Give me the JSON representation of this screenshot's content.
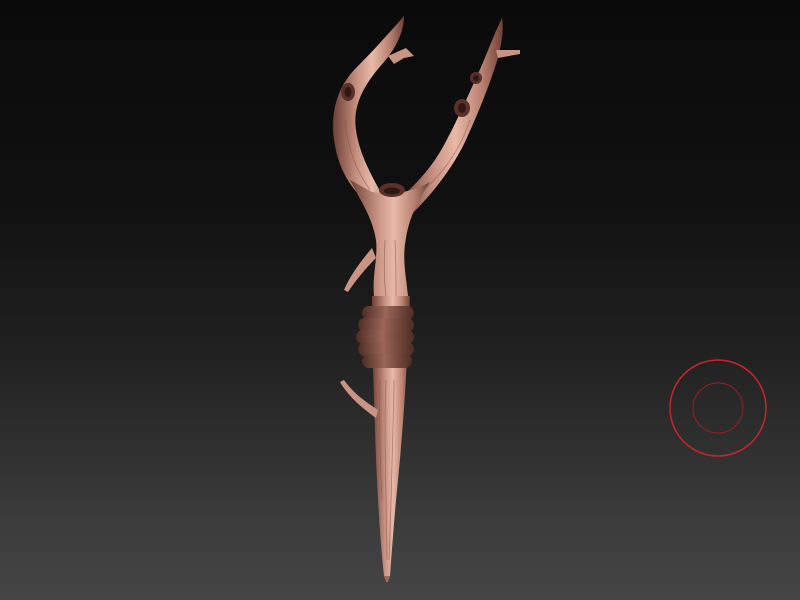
{
  "viewport": {
    "background_top": "#0a0a0a",
    "background_bottom": "#454545"
  },
  "model": {
    "subject": "sculpted-branch-staff",
    "material_base": "#b98272",
    "material_highlight": "#e8b9a8",
    "material_shadow": "#6e4034",
    "wrap_color": "#8a5a4e"
  },
  "brush": {
    "icon": "brush-cursor-icon",
    "outer_ring_color": "#c8252a",
    "inner_ring_color": "#a01d22"
  }
}
